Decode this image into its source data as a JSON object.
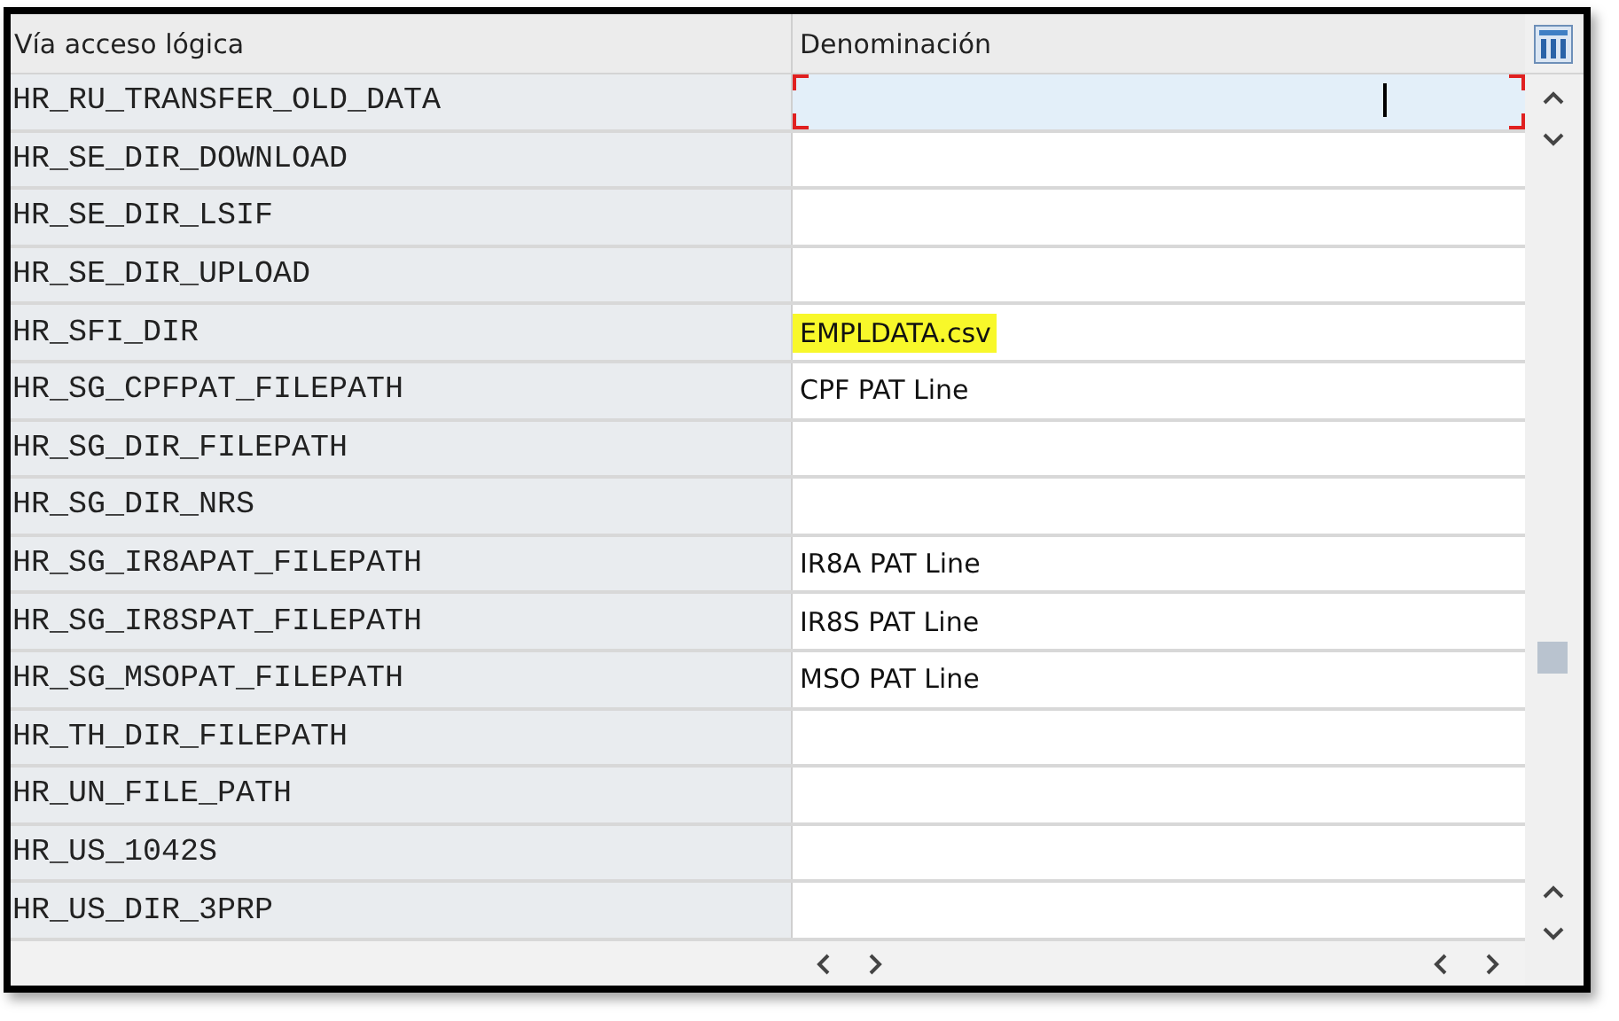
{
  "table": {
    "columns": [
      "Vía acceso lógica",
      "Denominación"
    ],
    "rows": [
      {
        "path": "HR_RU_TRANSFER_OLD_DATA",
        "selected": true,
        "highlighted": false
      },
      {
        "path": "HR_SE_DIR_DOWNLOAD",
        "selected": false,
        "highlighted": false
      },
      {
        "path": "HR_SE_DIR_LSIF",
        "selected": false,
        "highlighted": false
      },
      {
        "path": "HR_SE_DIR_UPLOAD",
        "selected": false,
        "highlighted": false
      },
      {
        "path": "HR_SFI_DIR",
        "name": "EMPLDATA.csv",
        "selected": false,
        "highlighted": true
      },
      {
        "path": "HR_SG_CPFPAT_FILEPATH",
        "name": "CPF PAT Line",
        "selected": false,
        "highlighted": false
      },
      {
        "path": "HR_SG_DIR_FILEPATH",
        "selected": false,
        "highlighted": false
      },
      {
        "path": "HR_SG_DIR_NRS",
        "selected": false,
        "highlighted": false
      },
      {
        "path": "HR_SG_IR8APAT_FILEPATH",
        "name": "IR8A PAT Line",
        "selected": false,
        "highlighted": false
      },
      {
        "path": "HR_SG_IR8SPAT_FILEPATH",
        "name": "IR8S PAT Line",
        "selected": false,
        "highlighted": false
      },
      {
        "path": "HR_SG_MSOPAT_FILEPATH",
        "name": "MSO PAT Line",
        "selected": false,
        "highlighted": false
      },
      {
        "path": "HR_TH_DIR_FILEPATH",
        "selected": false,
        "highlighted": false
      },
      {
        "path": "HR_UN_FILE_PATH",
        "selected": false,
        "highlighted": false
      },
      {
        "path": "HR_US_1042S",
        "selected": false,
        "highlighted": false
      },
      {
        "path": "HR_US_DIR_3PRP",
        "selected": false,
        "highlighted": false
      }
    ]
  }
}
